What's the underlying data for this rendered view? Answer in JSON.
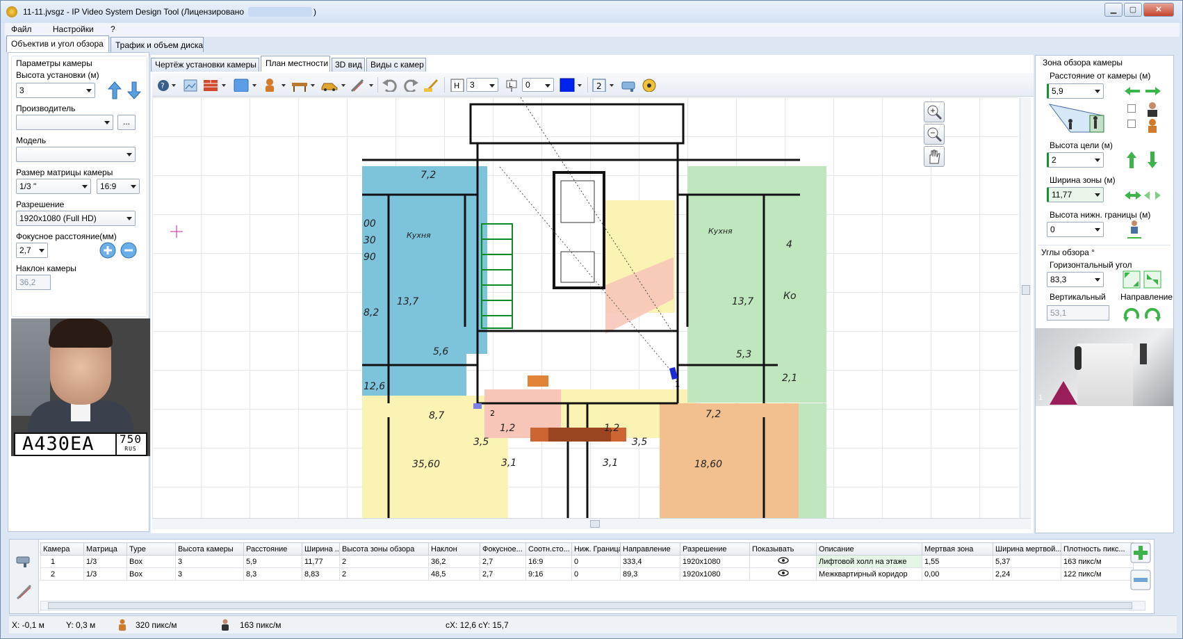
{
  "window": {
    "title": "11-11.jvsgz - IP Video System Design Tool (Лицензировано",
    "title_tail": ")",
    "min_label": "▁",
    "max_label": "▢",
    "close_label": "✕"
  },
  "menu": {
    "file": "Файл",
    "settings": "Настройки",
    "help": "?"
  },
  "left_tabs": {
    "lens": "Объектив и угол обзора",
    "traffic": "Трафик и объем диска"
  },
  "camera_params": {
    "group_title": "Параметры камеры",
    "height_label": "Высота установки (м)",
    "height_value": "3",
    "manufacturer_label": "Производитель",
    "manufacturer_value": "",
    "browse_label": "...",
    "model_label": "Модель",
    "model_value": "",
    "sensor_label": "Размер матрицы камеры",
    "sensor_value": "1/3 \"",
    "aspect_value": "16:9",
    "resolution_label": "Разрешение",
    "resolution_value": "1920x1080 (Full HD)",
    "focal_label": "Фокусное расстояние(мм)",
    "focal_value": "2,7",
    "tilt_label": "Наклон камеры",
    "tilt_value": "36,2"
  },
  "preview": {
    "plate_text": "A430EA",
    "plate_region": "750",
    "plate_country": "RUS"
  },
  "view_tabs": {
    "drawing": "Чертёж установки камеры",
    "plan": "План местности",
    "view3d": "3D вид",
    "camviews": "Виды с камер"
  },
  "toolbar": {
    "height_value": "3",
    "level_value": "0",
    "layer_value": "2",
    "accent_color": "#0022ee"
  },
  "plan": {
    "room_labels": [
      "7,2",
      "Кухня",
      "13,7",
      "5,6",
      "12,6",
      "8,7",
      "1,2",
      "3,5",
      "3,1",
      "35,60",
      "1,2",
      "3,1",
      "3,5",
      "18,60",
      "7,2",
      "2,1",
      "5,3",
      "13,7",
      "Кухня",
      "4",
      "Ко",
      "8,2",
      "00",
      "30",
      "90"
    ],
    "camera1_label": "1",
    "camera2_label": "2",
    "colors": {
      "blue": "#7ec3dc",
      "yellow": "#fbf3b4",
      "orange": "#f2c08f",
      "green": "#bfe6bd",
      "pink": "#f7c6b8"
    }
  },
  "zone": {
    "title": "Зона обзора камеры",
    "distance_label": "Расстояние от камеры (м)",
    "distance_value": "5,9",
    "target_height_label": "Высота цели (м)",
    "target_height_value": "2",
    "zone_width_label": "Ширина зоны (м)",
    "zone_width_value": "11,77",
    "lower_height_label": "Высота нижн. границы (м)",
    "lower_height_value": "0"
  },
  "angles": {
    "title": "Углы обзора °",
    "horizontal_label": "Горизонтальный угол",
    "horizontal_value": "83,3",
    "vertical_label": "Вертикальный",
    "vertical_value": "53,1",
    "direction_label": "Направление"
  },
  "mini_view": {
    "camera_index": "1"
  },
  "table": {
    "headers": [
      "Камера",
      "Матрица",
      "Type",
      "Высота камеры",
      "Расстояние",
      "Ширина ...",
      "Высота зоны обзора",
      "Наклон",
      "Фокусное...",
      "Соотн.сто...",
      "Ниж. Граница",
      "Направление",
      "Разрешение",
      "Показывать",
      "Описание",
      "Мертвая зона",
      "Ширина мертвой...",
      "Плотность пикс..."
    ],
    "rows": [
      [
        "1",
        "1/3",
        "Box",
        "3",
        "5,9",
        "11,77",
        "2",
        "36,2",
        "2,7",
        "16:9",
        "0",
        "333,4",
        "1920x1080",
        "",
        "Лифтовой холл на этаже",
        "1,55",
        "5,37",
        "163 пикс/м"
      ],
      [
        "2",
        "1/3",
        "Box",
        "3",
        "8,3",
        "8,83",
        "2",
        "48,5",
        "2,7",
        "9:16",
        "0",
        "89,3",
        "1920x1080",
        "",
        "Межквартирный коридор",
        "0,00",
        "2,24",
        "122 пикс/м"
      ]
    ]
  },
  "status": {
    "x": "X: -0,1 м",
    "y": "Y: 0,3 м",
    "density1": "320 пикс/м",
    "density2": "163 пикс/м",
    "center": "cX: 12,6 cY: 15,7"
  }
}
